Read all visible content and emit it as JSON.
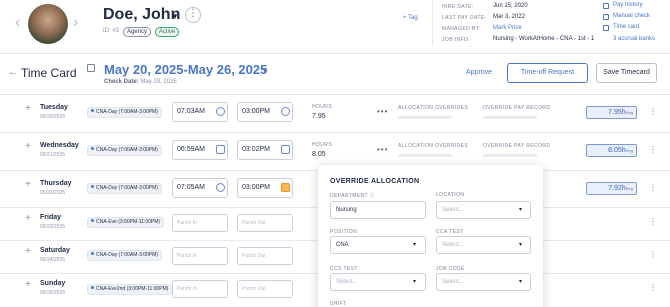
{
  "header": {
    "name": "Doe, John",
    "id": "ID: #3",
    "badges": [
      "Agency",
      "Active"
    ],
    "tag_link": "+ Tag",
    "info": [
      {
        "label": "HIRE DATE:",
        "value": "Jun 15, 2020"
      },
      {
        "label": "LAST PAY DATE:",
        "value": "Mar 3, 2022"
      },
      {
        "label": "MANAGED BY:",
        "value": "Mark Price"
      },
      {
        "label": "JOB INFO:",
        "value": "Nursing - WorkAtHome - CNA - 1st - 1"
      }
    ],
    "side_links": [
      "Pay history",
      "Manual check",
      "Time card",
      "3 accrual banks"
    ]
  },
  "timecard": {
    "title": "Time Card",
    "date_range": "May 20, 2025-May 26, 2025",
    "check_date_label": "Check Date:",
    "check_date": "May 29, 2025",
    "approve": "Approve",
    "time_off": "Time-off Request",
    "save": "Save Timecard"
  },
  "labels": {
    "hours": "HOURS",
    "allocation": "ALLOCATION OVERRIDES",
    "override_pay": "OVERRIDE PAY RECORD",
    "punch_in": "Punch In",
    "punch_out": "Punch Out",
    "reg": "Reg"
  },
  "rows": [
    {
      "day": "Tuesday",
      "date": "05/20/2025",
      "shift": "CNA-Day (7:00AM-3:00PM)",
      "in": "07:03AM",
      "out": "03:00PM",
      "hours": "7.95",
      "reg": "7.95h"
    },
    {
      "day": "Wednesday",
      "date": "05/21/2025",
      "shift": "CNA-Day (7:00AM-3:00PM)",
      "in": "06:59AM",
      "out": "03:02PM",
      "hours": "8.05",
      "reg": "8.05h"
    },
    {
      "day": "Thursday",
      "date": "05/22/2025",
      "shift": "CNA-Day (7:00AM-3:00PM)",
      "in": "07:05AM",
      "out": "03:00PM",
      "hours": "",
      "reg": "7.92h"
    },
    {
      "day": "Friday",
      "date": "05/23/2025",
      "shift": "CNA-Eve (3:00PM-11:00PM)"
    },
    {
      "day": "Saturday",
      "date": "05/24/2025",
      "shift": "CNA-Day (7:00AM-3:00PM)"
    },
    {
      "day": "Sunday",
      "date": "05/25/2025",
      "shift": "CNA-Eve2nd (3:00PM-11:00PM)"
    }
  ],
  "override_popover": {
    "title": "OVERRIDE ALLOCATION",
    "department_label": "DEPARTMENT",
    "department_value": "Nursing",
    "location_label": "LOCATION",
    "location_value": "Select...",
    "position_label": "POSITION",
    "position_value": "CNA",
    "cca_test_label": "CCA TEST",
    "cca_test_value": "Select...",
    "ccs_test_label": "CCS TEST",
    "ccs_test_value": "Select...",
    "job_code_label": "JOB CODE",
    "job_code_value": "Select...",
    "shift_label": "SHIFT"
  }
}
